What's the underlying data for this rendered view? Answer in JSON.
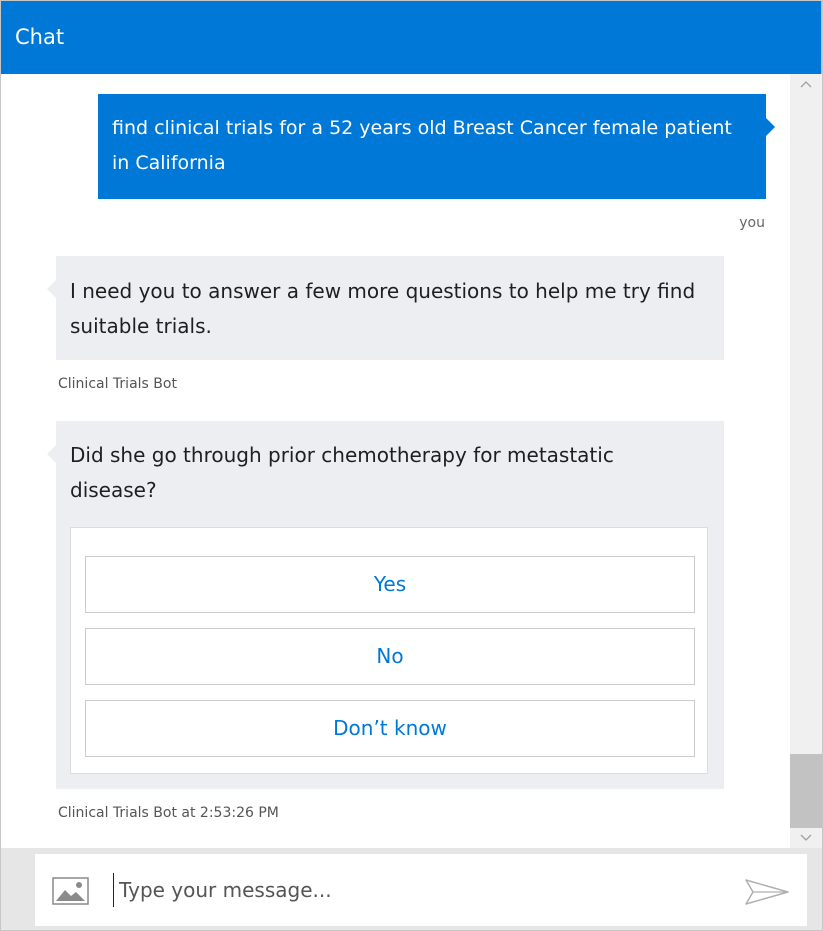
{
  "header": {
    "title": "Chat"
  },
  "messages": {
    "user": {
      "text": "find clinical trials for a 52 years old Breast Cancer female patient in California",
      "sender": "you"
    },
    "bot1": {
      "text": "I need you to answer a few more questions to help me try find suitable trials.",
      "sender": "Clinical Trials Bot"
    },
    "bot2": {
      "text": "Did she go through prior chemotherapy for metastatic disease?",
      "actions": [
        "Yes",
        "No",
        "Don’t know"
      ],
      "sender": "Clinical Trials Bot at 2:53:26 PM"
    }
  },
  "input": {
    "placeholder": "Type your message...",
    "value": ""
  },
  "icons": {
    "upload": "image-upload-icon",
    "send": "send-icon",
    "scroll_up": "chevron-up-icon",
    "scroll_down": "chevron-down-icon"
  },
  "colors": {
    "accent": "#0078d7",
    "bot_bubble": "#eceef1",
    "input_bar": "#e6e6e6"
  }
}
